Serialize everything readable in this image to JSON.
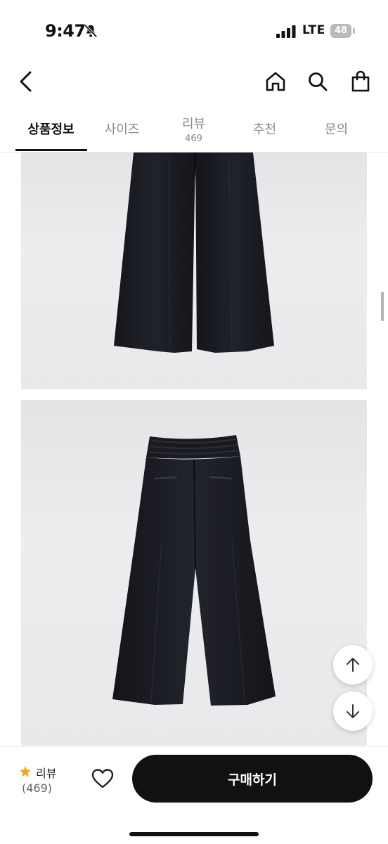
{
  "status_bar": {
    "time": "9:47",
    "network": "LTE",
    "battery": "48"
  },
  "header": {
    "icons": [
      "back-icon",
      "home-icon",
      "search-icon",
      "shopping-bag-icon"
    ]
  },
  "tabs": [
    {
      "label": "상품정보",
      "active": true
    },
    {
      "label": "사이즈",
      "active": false
    },
    {
      "label": "리뷰",
      "count": "469",
      "active": false
    },
    {
      "label": "추천",
      "active": false
    },
    {
      "label": "문의",
      "active": false
    }
  ],
  "floating_buttons": {
    "icons": [
      "arrow-up-icon",
      "arrow-down-icon"
    ]
  },
  "bottom_bar": {
    "review_label": "리뷰",
    "review_count": "(469)",
    "buy_label": "구매하기"
  },
  "colors": {
    "accent_star": "#f5a623",
    "primary": "#111111",
    "pants": "#1b1c21"
  }
}
